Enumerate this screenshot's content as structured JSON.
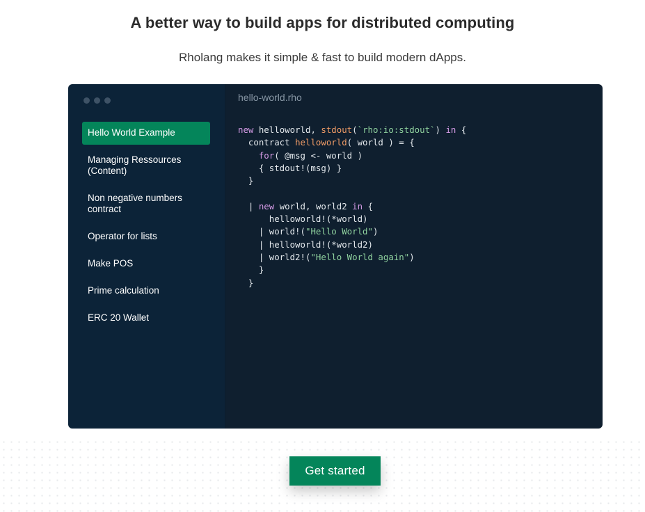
{
  "hero": {
    "title": "A better way to build apps for distributed computing",
    "subtitle": "Rholang makes it simple & fast to build modern dApps."
  },
  "sidebar": {
    "items": [
      {
        "label": "Hello World Example",
        "active": true
      },
      {
        "label": "Managing Ressources (Content)",
        "active": false
      },
      {
        "label": "Non negative numbers contract",
        "active": false
      },
      {
        "label": "Operator for lists",
        "active": false
      },
      {
        "label": "Make POS",
        "active": false
      },
      {
        "label": "Prime calculation",
        "active": false
      },
      {
        "label": "ERC 20 Wallet",
        "active": false
      }
    ]
  },
  "editor": {
    "file_name": "hello-world.rho",
    "code_lines": [
      [
        {
          "t": "new",
          "c": "kw"
        },
        {
          "t": " helloworld, "
        },
        {
          "t": "stdout",
          "c": "fn"
        },
        {
          "t": "("
        },
        {
          "t": "`rho:io:stdout`",
          "c": "str"
        },
        {
          "t": ") "
        },
        {
          "t": "in",
          "c": "kw"
        },
        {
          "t": " {"
        }
      ],
      [
        {
          "t": "  contract "
        },
        {
          "t": "helloworld",
          "c": "fn"
        },
        {
          "t": "( world ) = {"
        }
      ],
      [
        {
          "t": "    "
        },
        {
          "t": "for",
          "c": "kw"
        },
        {
          "t": "( @msg <- world )"
        }
      ],
      [
        {
          "t": "    { stdout!(msg) }"
        }
      ],
      [
        {
          "t": "  }"
        }
      ],
      [
        {
          "t": ""
        }
      ],
      [
        {
          "t": "  | "
        },
        {
          "t": "new",
          "c": "kw"
        },
        {
          "t": " world, world2 "
        },
        {
          "t": "in",
          "c": "kw"
        },
        {
          "t": " {"
        }
      ],
      [
        {
          "t": "      helloworld!(*world)"
        }
      ],
      [
        {
          "t": "    | world!("
        },
        {
          "t": "\"Hello World\"",
          "c": "str"
        },
        {
          "t": ")"
        }
      ],
      [
        {
          "t": "    | helloworld!(*world2)"
        }
      ],
      [
        {
          "t": "    | world2!("
        },
        {
          "t": "\"Hello World again\"",
          "c": "str"
        },
        {
          "t": ")"
        }
      ],
      [
        {
          "t": "    }"
        }
      ],
      [
        {
          "t": "  }"
        }
      ]
    ]
  },
  "cta": {
    "label": "Get started"
  },
  "colors": {
    "accent": "#04855a",
    "sidebar_bg": "#0c2338",
    "code_bg": "#0f1f2f",
    "keyword": "#d59be6",
    "function": "#ef9b66",
    "string": "#8fd19e"
  }
}
